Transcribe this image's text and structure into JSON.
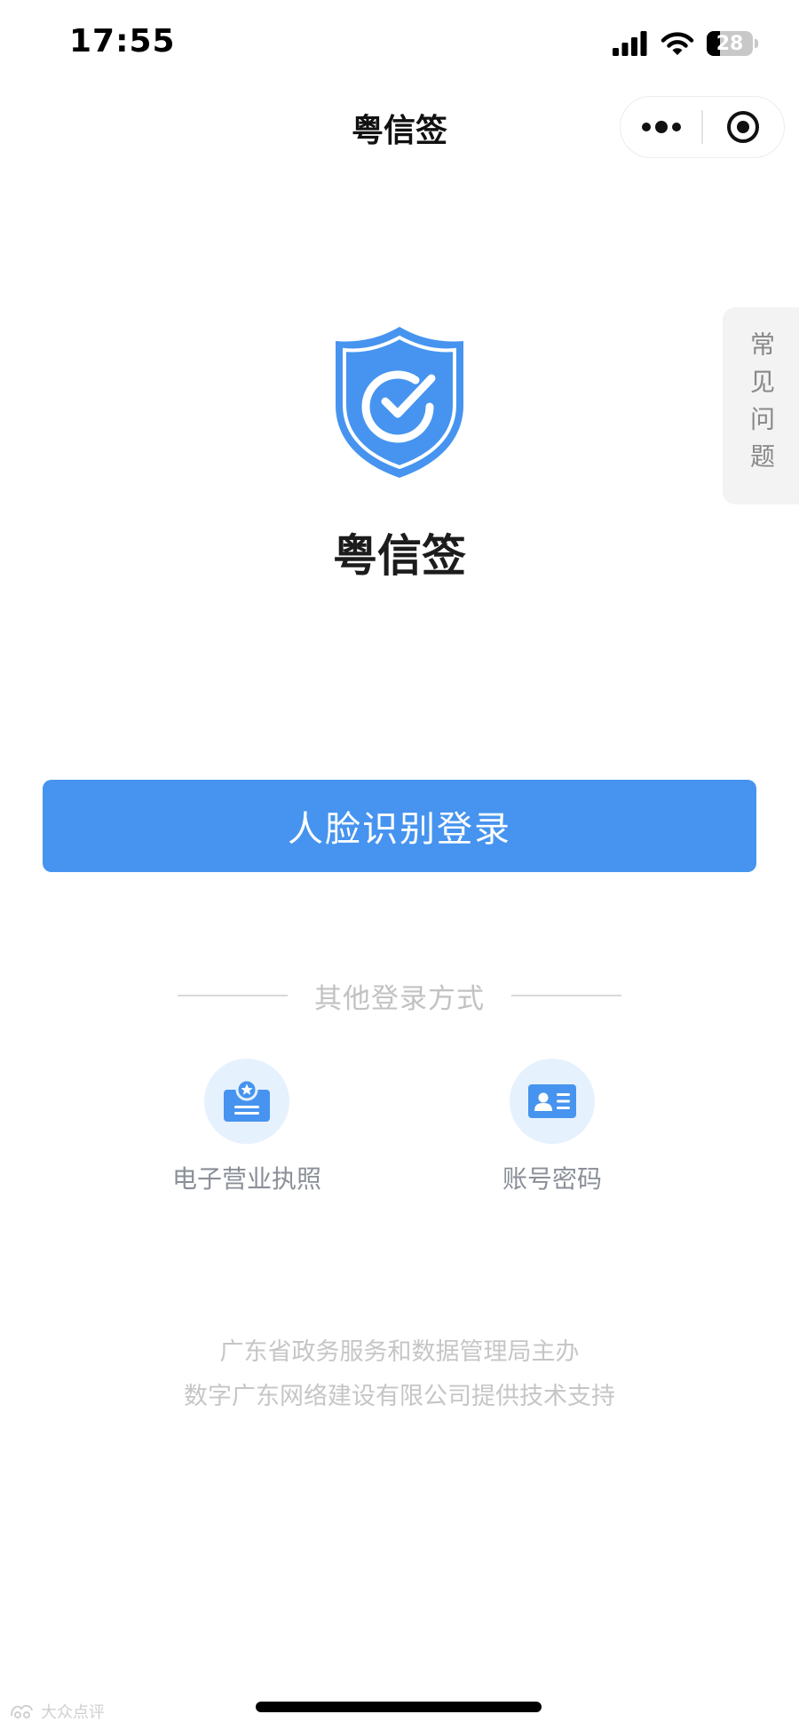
{
  "status_bar": {
    "time": "17:55",
    "battery_percent": "28",
    "icons": [
      "signal-icon",
      "wifi-icon",
      "battery-icon"
    ]
  },
  "nav": {
    "title": "粤信签",
    "capsule_icons": [
      "more-dots-icon",
      "close-miniprogram-icon"
    ]
  },
  "faq_tab": {
    "label": "常见问题"
  },
  "app": {
    "name": "粤信签",
    "logo_icon": "shield-check-icon"
  },
  "face_login_button": {
    "label": "人脸识别登录"
  },
  "other_login": {
    "title": "其他登录方式",
    "options": [
      {
        "label": "电子营业执照",
        "icon": "business-license-icon"
      },
      {
        "label": "账号密码",
        "icon": "id-card-icon"
      }
    ]
  },
  "footer": {
    "line1": "广东省政务服务和数据管理局主办",
    "line2": "数字广东网络建设有限公司提供技术支持"
  },
  "watermark": {
    "text": "大众点评"
  },
  "colors": {
    "primary": "#4694ef",
    "icon_bg": "#e6f1fe",
    "faq_bg": "#f3f3f3",
    "muted_text": "#c6c6c6"
  }
}
